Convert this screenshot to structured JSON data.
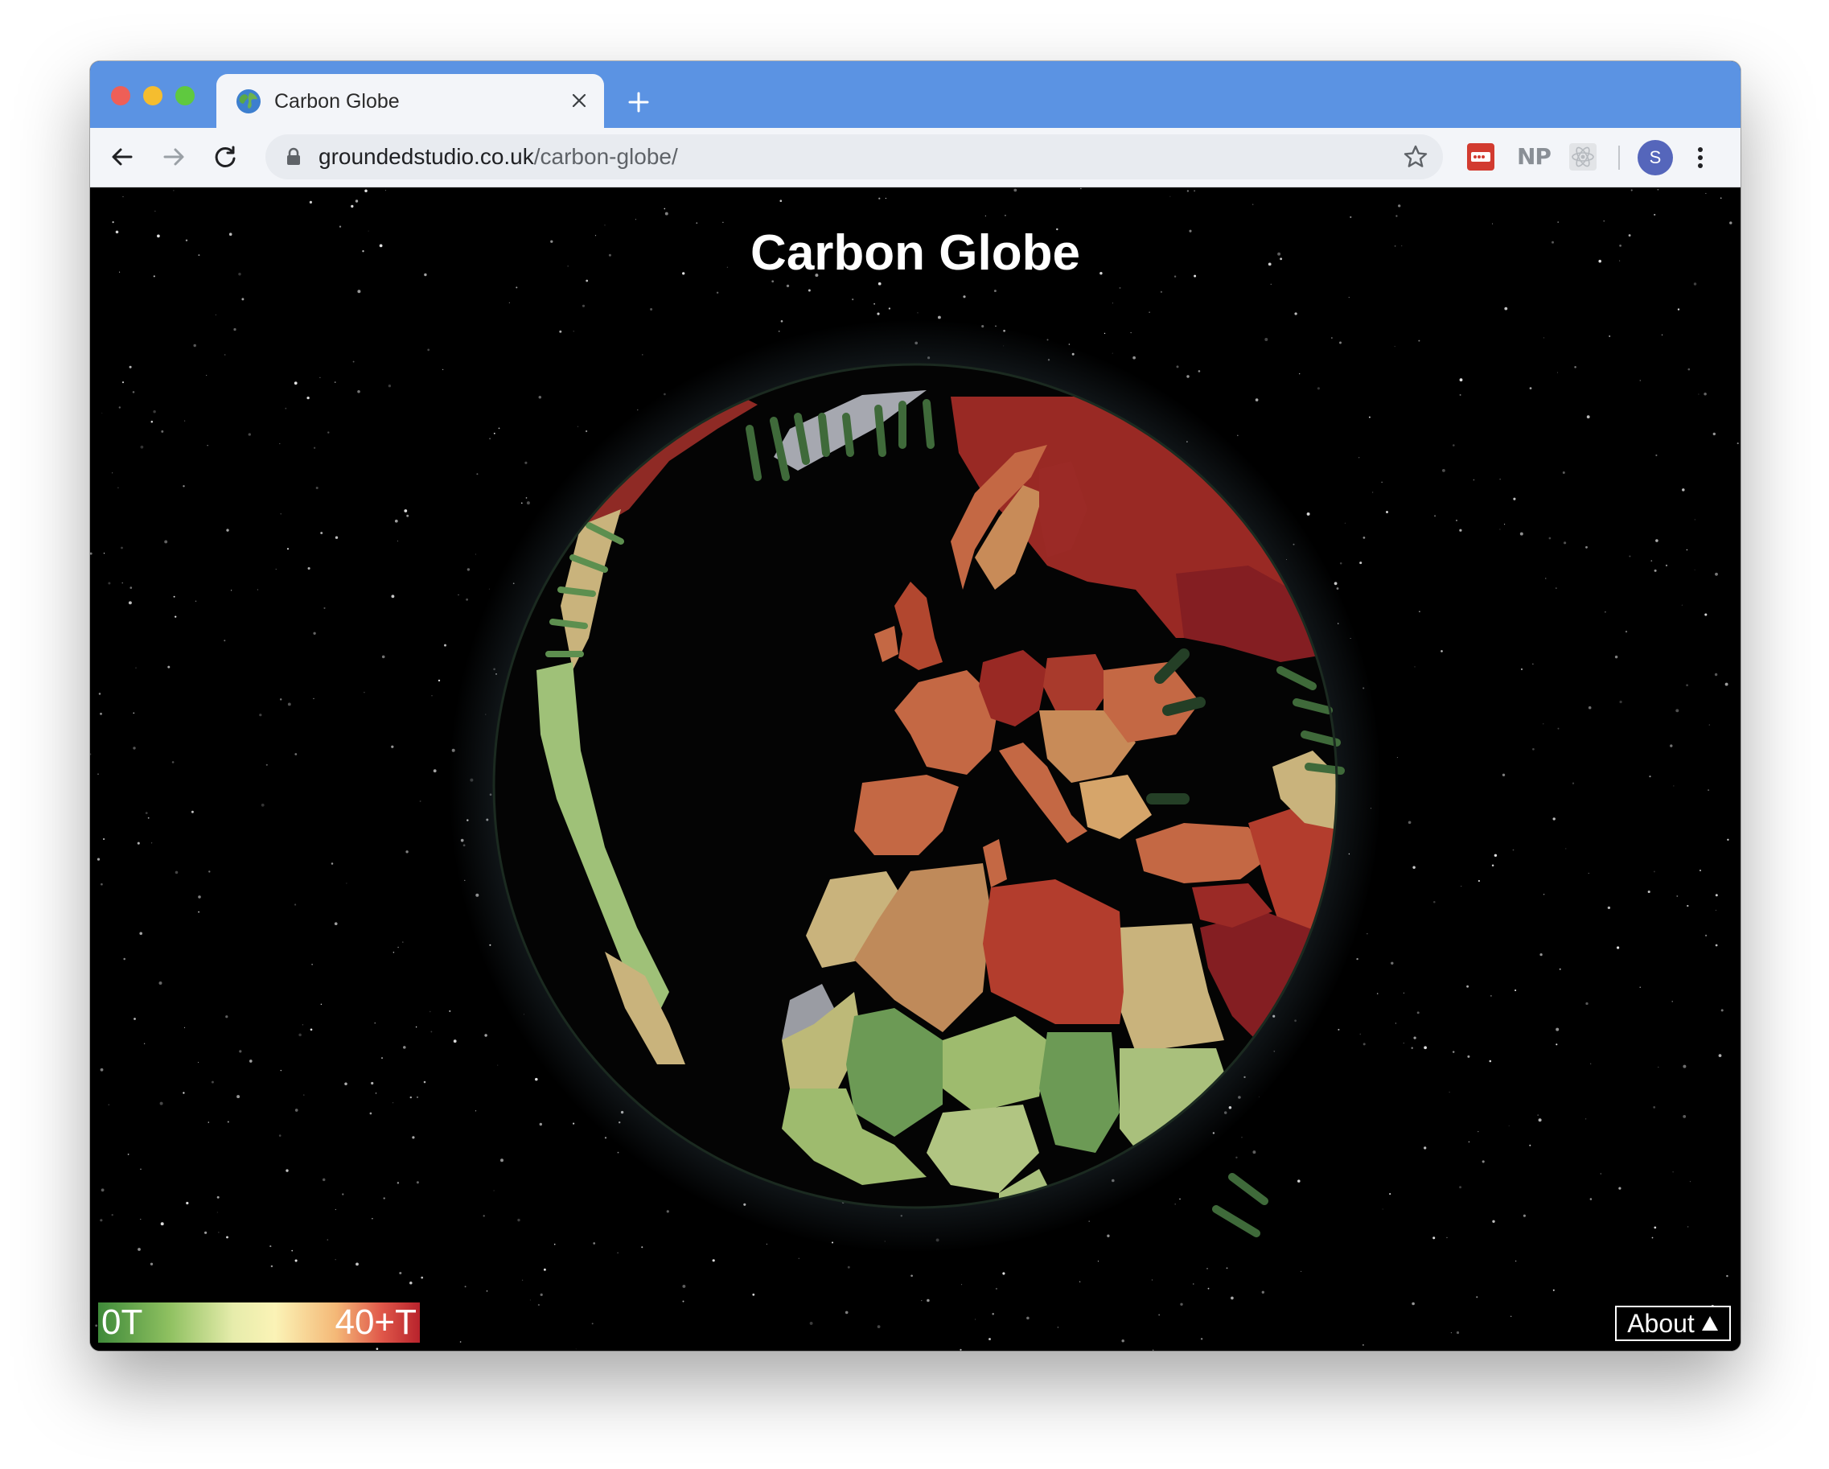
{
  "browser": {
    "tab_title": "Carbon Globe",
    "url_host": "groundedstudio.co.uk",
    "url_path": "/carbon-globe/",
    "extension_np": "NP",
    "profile_initial": "S"
  },
  "page": {
    "title": "Carbon Globe",
    "legend": {
      "min_label": "0T",
      "max_label": "40+T",
      "colors": [
        "#3f8a3a",
        "#8ec060",
        "#e6ecab",
        "#fbf3b6",
        "#f4b877",
        "#e0584a",
        "#b8232c"
      ]
    },
    "about_label": "About"
  },
  "colors": {
    "tabbar": "#5b93e3",
    "toolbar": "#f3f5f9",
    "space": "#000000",
    "high_emissions": "#9b2a26",
    "medium_emissions": "#c46844",
    "low_emissions": "#6c9a55",
    "no_data": "#9a9ca3"
  }
}
